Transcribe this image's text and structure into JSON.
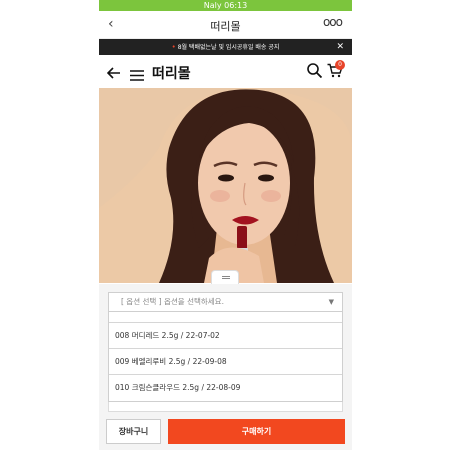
{
  "status_bar": {
    "text": "Naly 06:13"
  },
  "title_bar": {
    "back_glyph": "‹",
    "title": "떠리몰",
    "more_glyph": "ooo"
  },
  "notice": {
    "text": "8월 택배없는날 및 임시공휴일 배송 공지",
    "close_glyph": "✕"
  },
  "shop_header": {
    "name": "떠리몰",
    "cart_count": "0"
  },
  "product": {
    "image_description": "lipstick model photo"
  },
  "option_select": {
    "placeholder": "[ 옵션 선택 ] 옵션을 선택하세요.",
    "caret": "▼",
    "options": [
      {
        "label": "008 머디레드 2.5g / 22-07-02"
      },
      {
        "label": "009 베엘리루비 2.5g / 22-09-08"
      },
      {
        "label": "010 크림슨클라우드 2.5g / 22-08-09"
      }
    ]
  },
  "actions": {
    "cart_label": "장바구니",
    "buy_label": "구매하기"
  },
  "colors": {
    "status_green": "#7cc53d",
    "buy_orange": "#f2481f",
    "badge_red": "#e8442a"
  }
}
